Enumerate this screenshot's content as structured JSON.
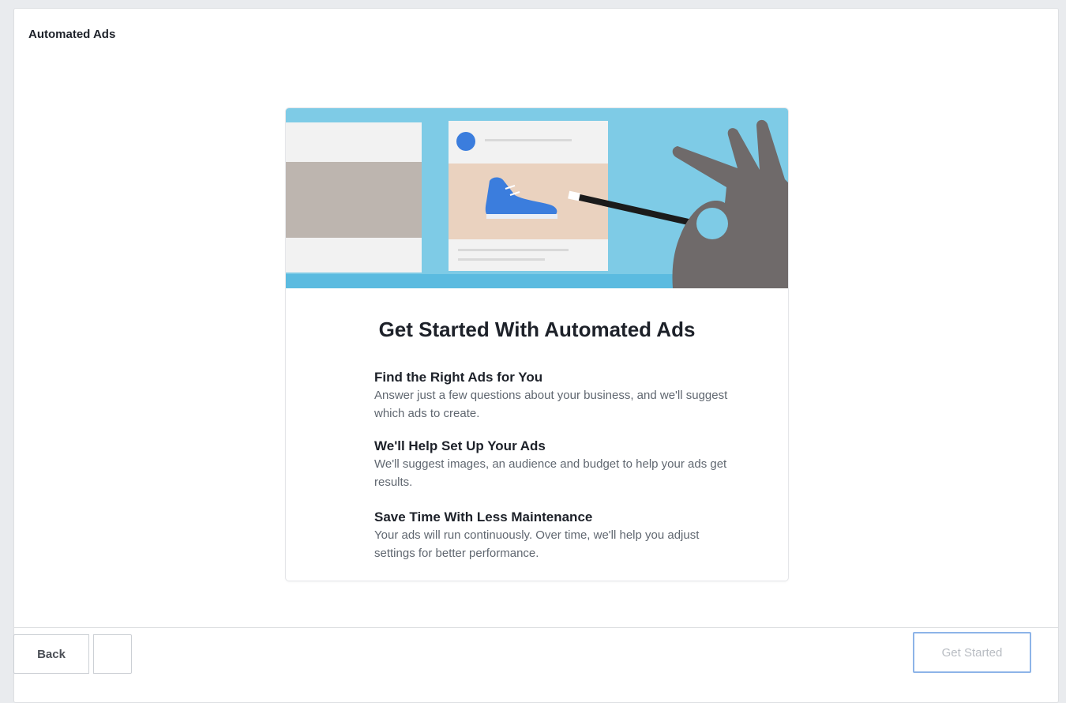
{
  "panel": {
    "title": "Automated Ads"
  },
  "card": {
    "heading": "Get Started With Automated Ads",
    "features": [
      {
        "title": "Find the Right Ads for You",
        "description": "Answer just a few questions about your business, and we'll suggest which ads to create."
      },
      {
        "title": "We'll Help Set Up Your Ads",
        "description": "We'll suggest images, an audience and budget to help your ads get results."
      },
      {
        "title": "Save Time With Less Maintenance",
        "description": "Your ads will run continuously. Over time, we'll help you adjust settings for better performance."
      }
    ],
    "illustration_icons": [
      "sneaker-icon",
      "magic-wand-icon",
      "hand-icon"
    ]
  },
  "footer": {
    "back_label": "Back",
    "extra_label": "",
    "get_started_label": "Get Started"
  },
  "colors": {
    "hero_background": "#7ecbe6",
    "sneaker": "#3b7ddd",
    "hand": "#6f6a6a",
    "primary_button_border": "#8db4e8"
  }
}
